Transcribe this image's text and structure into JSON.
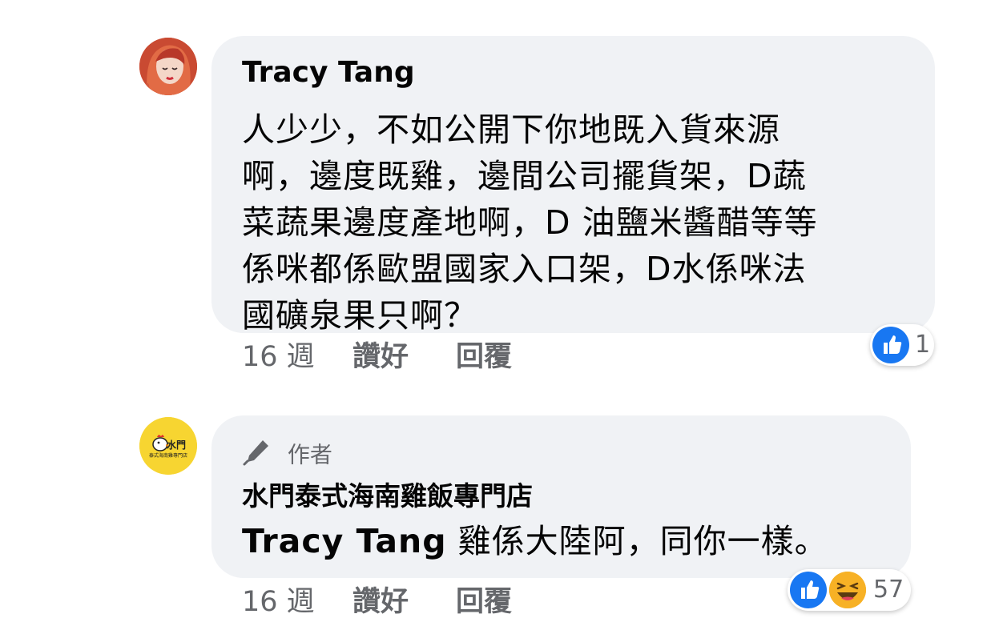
{
  "comments": [
    {
      "author": "Tracy Tang",
      "lines": [
        "人少少，不如公開下你地既入貨來源",
        "啊，邊度既雞，邊間公司擺貨架，D蔬",
        "菜蔬果邊度產地啊，D 油鹽米醬醋等等",
        "係咪都係歐盟國家入口架，D水係咪法",
        "國礦泉果只啊？"
      ],
      "time": "16 週",
      "like_label": "讚好",
      "reply_label": "回覆",
      "reactions": {
        "icons": [
          "like-icon"
        ],
        "count": "1"
      }
    },
    {
      "badge": "作者",
      "author": "水門泰式海南雞飯專門店",
      "mention": "Tracy Tang",
      "text": " 雞係大陸阿，同你一樣。",
      "time": "16 週",
      "like_label": "讚好",
      "reply_label": "回覆",
      "reactions": {
        "icons": [
          "like-icon",
          "haha-icon"
        ],
        "count": "57"
      },
      "avatar_logo": "水門",
      "avatar_caption": "泰式海南雞專門店"
    }
  ],
  "colors": {
    "bubble": "#f0f2f5",
    "secondary_text": "#65676b",
    "like_blue": "#1877f2",
    "haha_yellow": "#f7b125",
    "avatar_yellow": "#f7d531"
  }
}
